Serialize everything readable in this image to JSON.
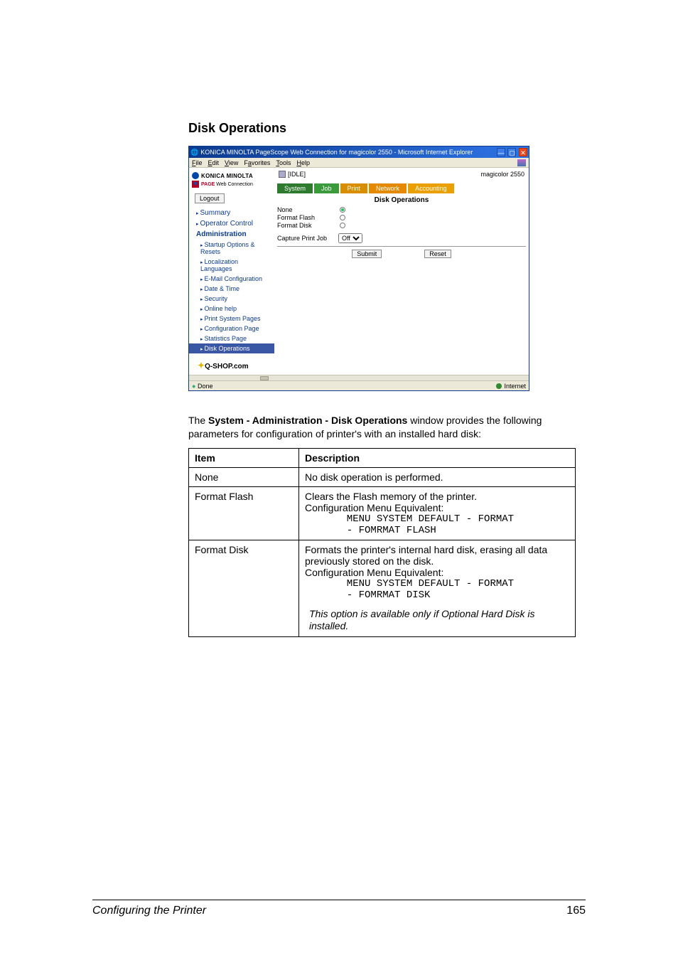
{
  "page": {
    "section_title": "Disk Operations",
    "intro_1": "The ",
    "intro_bold": "System - Administration - Disk Operations",
    "intro_2": " window provides the following parameters for configuration of printer's with an installed hard disk:",
    "footer_left": "Configuring the Printer",
    "footer_right": "165"
  },
  "ie": {
    "title": "KONICA MINOLTA PageScope Web Connection for magicolor 2550 - Microsoft Internet Explorer",
    "menu": {
      "file": "File",
      "edit": "Edit",
      "view": "View",
      "favorites": "Favorites",
      "tools": "Tools",
      "help": "Help"
    },
    "brand_line1": "KONICA MINOLTA",
    "brand_line2a": "PAGE",
    "brand_line2b": " Web Connection",
    "logout": "Logout",
    "printer_status": "[IDLE]",
    "product": "magicolor 2550",
    "tabs": {
      "system": "System",
      "job": "Job",
      "print": "Print",
      "network": "Network",
      "accounting": "Accounting"
    },
    "panel_title": "Disk Operations",
    "radios": {
      "none": "None",
      "flash": "Format Flash",
      "disk": "Format Disk"
    },
    "capture_label": "Capture Print Job",
    "capture_value": "Off",
    "buttons": {
      "submit": "Submit",
      "reset": "Reset"
    },
    "sidenav": {
      "summary": "Summary",
      "operator": "Operator Control",
      "admin": "Administration",
      "startup": "Startup Options & Resets",
      "local": "Localization Languages",
      "email": "E-Mail Configuration",
      "date": "Date & Time",
      "security": "Security",
      "online": "Online help",
      "psp": "Print System Pages",
      "cfg": "Configuration Page",
      "stat": "Statistics Page",
      "disk": "Disk Operations"
    },
    "qshop": "Q-SHOP.com",
    "status_left": "Done",
    "status_right": "Internet"
  },
  "table": {
    "h1": "Item",
    "h2": "Description",
    "rows": {
      "none": {
        "item": "None",
        "desc": "No disk operation is performed."
      },
      "flash": {
        "item": "Format Flash",
        "line1": "Clears the Flash memory of the printer.",
        "line2": "Configuration Menu Equivalent:",
        "mono": "       MENU SYSTEM DEFAULT - FORMAT\n       - FOMRMAT FLASH"
      },
      "disk": {
        "item": "Format Disk",
        "line1": "Formats the printer's internal hard disk, erasing all data previously stored on the disk.",
        "line2": "Configuration Menu Equivalent:",
        "mono": "       MENU SYSTEM DEFAULT - FORMAT\n       - FOMRMAT DISK",
        "note": "This option is available only if Optional Hard Disk is installed."
      }
    }
  }
}
